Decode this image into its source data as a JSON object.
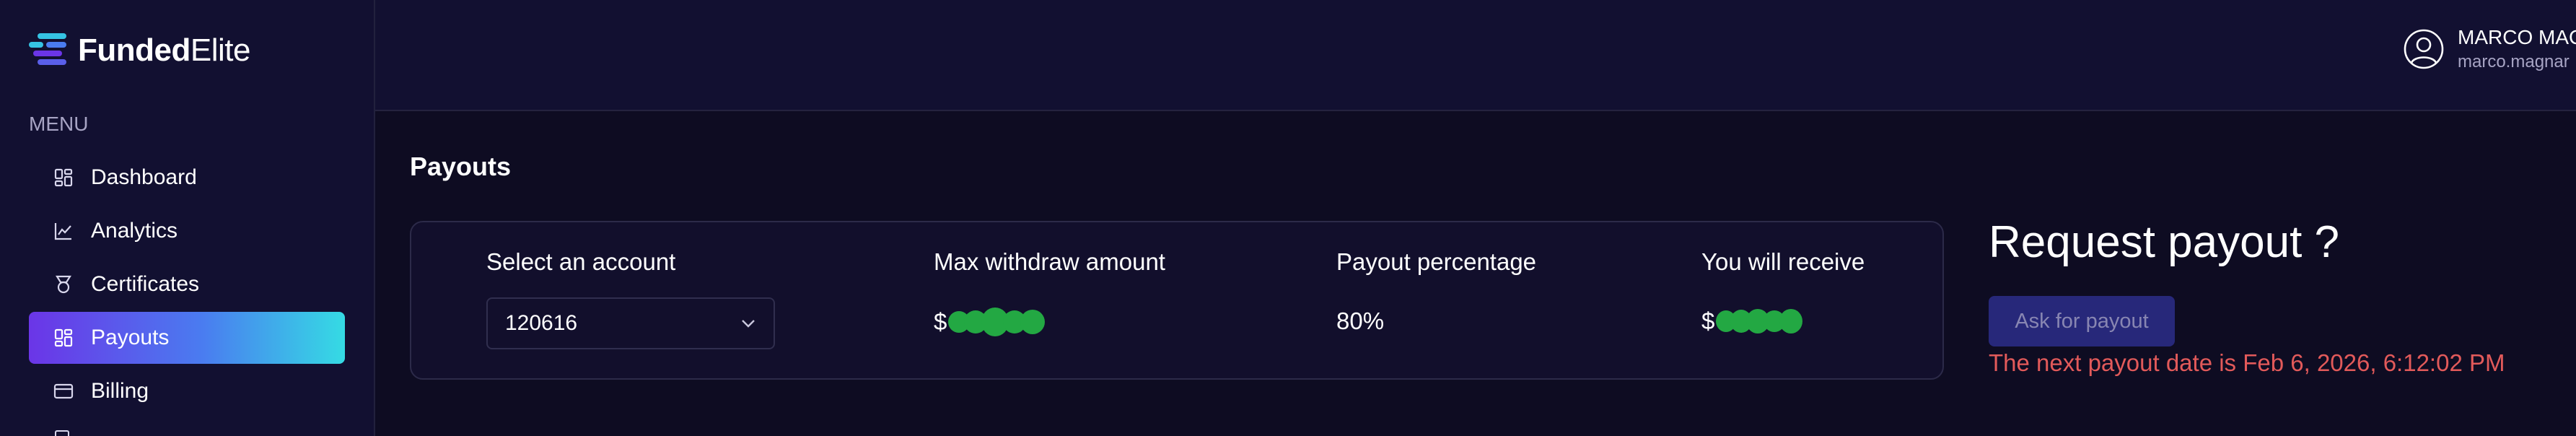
{
  "brand": {
    "name_bold": "Funded",
    "name_rest": "Elite"
  },
  "sidebar": {
    "menu_label": "MENU",
    "items": [
      {
        "label": "Dashboard",
        "icon": "dashboard-icon"
      },
      {
        "label": "Analytics",
        "icon": "chart-line-icon"
      },
      {
        "label": "Certificates",
        "icon": "medal-icon"
      },
      {
        "label": "Payouts",
        "icon": "payouts-icon",
        "active": true
      },
      {
        "label": "Billing",
        "icon": "credit-card-icon"
      }
    ]
  },
  "user": {
    "name": "MARCO MAC",
    "email": "marco.magnar"
  },
  "page": {
    "title": "Payouts"
  },
  "card": {
    "account_label": "Select an account",
    "account_value": "120616",
    "max_label": "Max withdraw amount",
    "max_currency": "$",
    "percentage_label": "Payout percentage",
    "percentage_value": "80%",
    "receive_label": "You will receive",
    "receive_currency": "$"
  },
  "request": {
    "title": "Request payout ?",
    "button_label": "Ask for payout",
    "next_date_text": "The next payout date is Feb 6, 2026, 6:12:02 PM"
  },
  "colors": {
    "background": "#0e0c22",
    "sidebar": "#121031",
    "accent_gradient_start": "#6b35e7",
    "accent_gradient_end": "#35dbe4",
    "redaction": "#23a843",
    "error_text": "#e25a5a",
    "button_bg": "#27287a"
  }
}
